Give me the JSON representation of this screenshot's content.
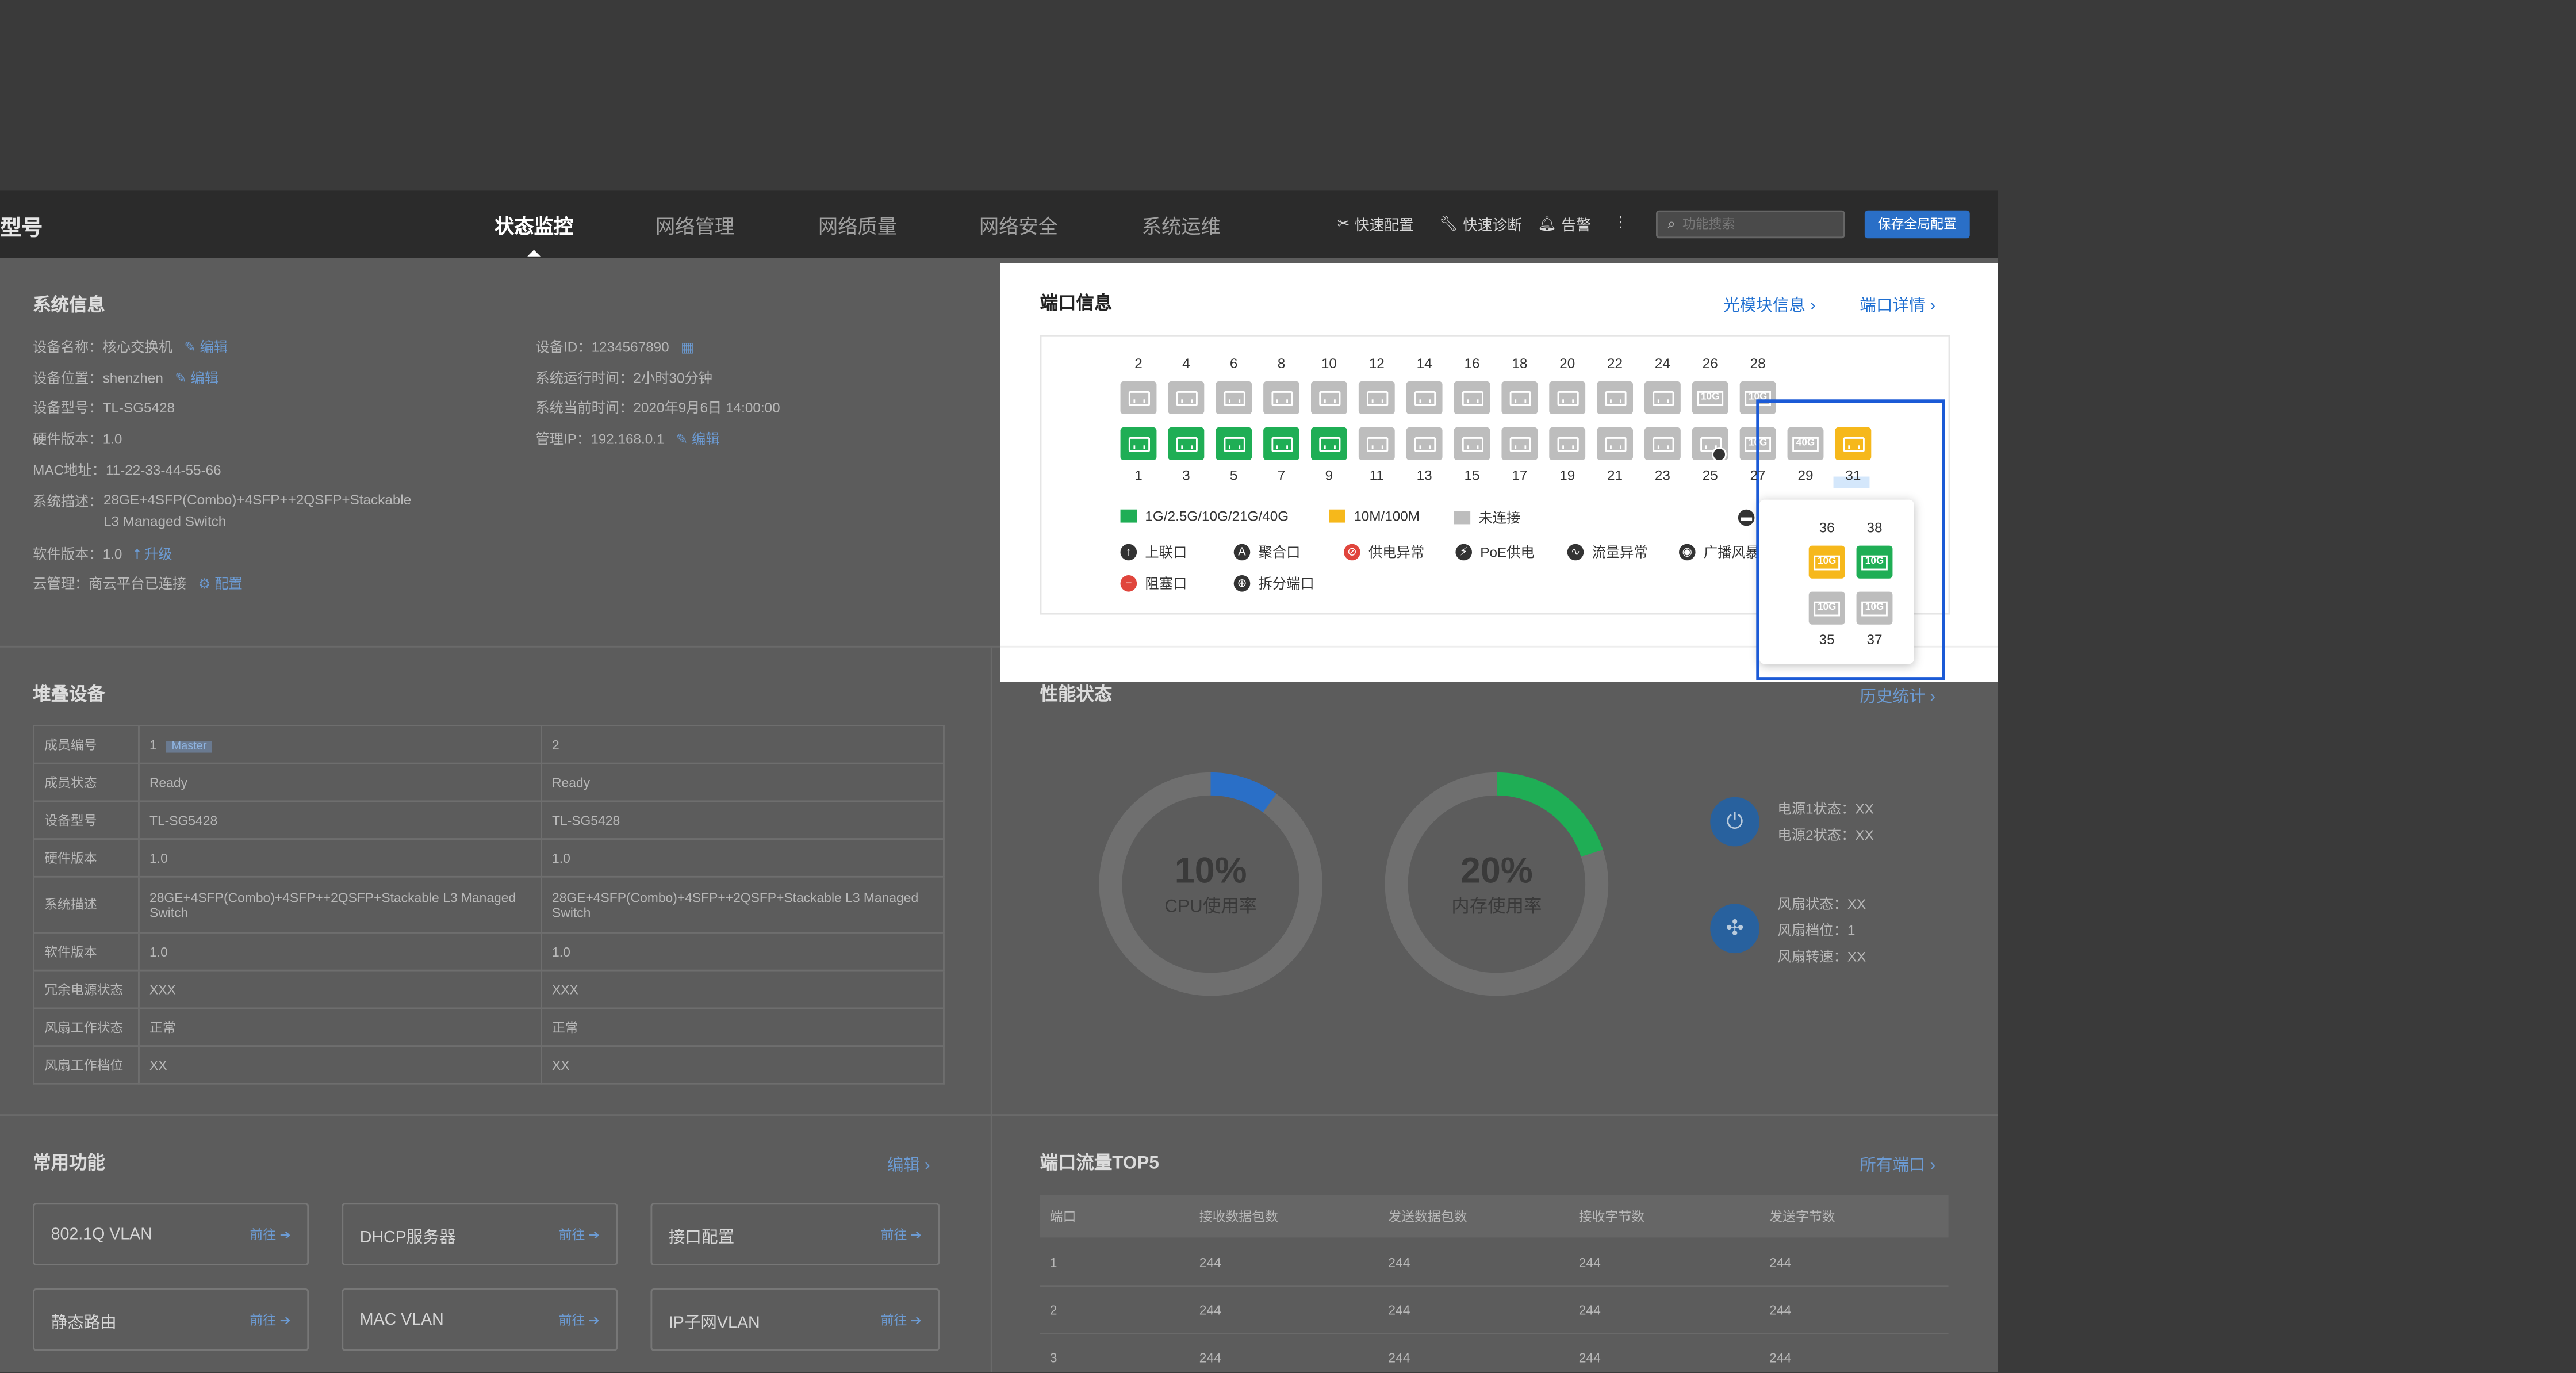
{
  "topbar": {
    "brand": "型号",
    "nav": [
      "状态监控",
      "网络管理",
      "网络质量",
      "网络安全",
      "系统运维"
    ],
    "quick_config": "快速配置",
    "quick_diag": "快速诊断",
    "alarm": "告警",
    "more": "⋮",
    "search_placeholder": "功能搜索",
    "save_button": "保存全局配置"
  },
  "system_info": {
    "title": "系统信息",
    "edit": "编辑",
    "device_name": "设备名称：核心交换机",
    "device_location": "设备位置：shenzhen",
    "device_model": "设备型号：TL-SG5428",
    "hw_version": "硬件版本：1.0",
    "mac": "MAC地址：11-22-33-44-55-66",
    "desc_label": "系统描述：",
    "desc_line1": "28GE+4SFP(Combo)+4SFP++2QSFP+Stackable",
    "desc_line2": "L3 Managed Switch",
    "sw_version": "软件版本：1.0",
    "upgrade": "升级",
    "cloud": "云管理：商云平台已连接",
    "config": "配置",
    "device_id": "设备ID：1234567890",
    "uptime": "系统运行时间：2小时30分钟",
    "current_time": "系统当前时间：2020年9月6日  14:00:00",
    "mgmt_ip": "管理IP：192.168.0.1"
  },
  "stack": {
    "title": "堆叠设备",
    "master_badge": "Master",
    "rows": [
      {
        "label": "成员编号",
        "a": "1",
        "b": "2"
      },
      {
        "label": "成员状态",
        "a": "Ready",
        "b": "Ready"
      },
      {
        "label": "设备型号",
        "a": "TL-SG5428",
        "b": "TL-SG5428"
      },
      {
        "label": "硬件版本",
        "a": "1.0",
        "b": "1.0"
      },
      {
        "label": "系统描述",
        "a": "28GE+4SFP(Combo)+4SFP++2QSFP+Stackable L3 Managed Switch",
        "b": "28GE+4SFP(Combo)+4SFP++2QSFP+Stackable L3 Managed Switch"
      },
      {
        "label": "软件版本",
        "a": "1.0",
        "b": "1.0"
      },
      {
        "label": "冗余电源状态",
        "a": "XXX",
        "b": "XXX"
      },
      {
        "label": "风扇工作状态",
        "a": "正常",
        "b": "正常"
      },
      {
        "label": "风扇工作档位",
        "a": "XX",
        "b": "XX"
      }
    ]
  },
  "common": {
    "title": "常用功能",
    "edit": "编辑",
    "go": "前往",
    "items": [
      "802.1Q VLAN",
      "DHCP服务器",
      "接口配置",
      "静态路由",
      "MAC VLAN",
      "IP子网VLAN"
    ]
  },
  "port_info": {
    "title": "端口信息",
    "optical_link": "光模块信息",
    "detail_link": "端口详情",
    "top_ports": [
      {
        "num": "2",
        "state": "gray",
        "kind": "eth"
      },
      {
        "num": "4",
        "state": "gray",
        "kind": "eth"
      },
      {
        "num": "6",
        "state": "gray",
        "kind": "eth"
      },
      {
        "num": "8",
        "state": "gray",
        "kind": "eth"
      },
      {
        "num": "10",
        "state": "gray",
        "kind": "eth"
      },
      {
        "num": "12",
        "state": "gray",
        "kind": "eth"
      },
      {
        "num": "14",
        "state": "gray",
        "kind": "eth"
      },
      {
        "num": "16",
        "state": "gray",
        "kind": "eth"
      },
      {
        "num": "18",
        "state": "gray",
        "kind": "eth"
      },
      {
        "num": "20",
        "state": "gray",
        "kind": "eth"
      },
      {
        "num": "22",
        "state": "gray",
        "kind": "eth"
      },
      {
        "num": "24",
        "state": "gray",
        "kind": "eth"
      },
      {
        "num": "26",
        "state": "gray",
        "kind": "sfp",
        "label": "10G"
      },
      {
        "num": "28",
        "state": "gray",
        "kind": "sfp",
        "label": "10G"
      }
    ],
    "bottom_ports": [
      {
        "num": "1",
        "state": "green",
        "kind": "eth"
      },
      {
        "num": "3",
        "state": "green",
        "kind": "eth"
      },
      {
        "num": "5",
        "state": "green",
        "kind": "eth"
      },
      {
        "num": "7",
        "state": "green",
        "kind": "eth"
      },
      {
        "num": "9",
        "state": "green",
        "kind": "eth"
      },
      {
        "num": "11",
        "state": "gray",
        "kind": "eth"
      },
      {
        "num": "13",
        "state": "gray",
        "kind": "eth"
      },
      {
        "num": "15",
        "state": "gray",
        "kind": "eth"
      },
      {
        "num": "17",
        "state": "gray",
        "kind": "eth"
      },
      {
        "num": "19",
        "state": "gray",
        "kind": "eth"
      },
      {
        "num": "21",
        "state": "gray",
        "kind": "eth"
      },
      {
        "num": "23",
        "state": "gray",
        "kind": "eth"
      },
      {
        "num": "25",
        "state": "gray",
        "kind": "eth"
      },
      {
        "num": "27",
        "state": "gray",
        "kind": "sfp",
        "label": "10G"
      },
      {
        "num": "29",
        "state": "gray",
        "kind": "sfp",
        "label": "40G"
      },
      {
        "num": "31",
        "state": "yellow",
        "kind": "eth"
      }
    ],
    "legend_speed": [
      {
        "label": "1G/2.5G/10G/21G/40G",
        "color": "#1fae55"
      },
      {
        "label": "10M/100M",
        "color": "#f6b81b"
      },
      {
        "label": "未连接",
        "color": "#bdbdbd"
      }
    ],
    "legend_icons": [
      "上联口",
      "聚合口",
      "供电异常",
      "PoE供电",
      "流量异常",
      "广播风暴",
      "电口",
      "阻塞口",
      "拆分端口"
    ],
    "popup": {
      "top_nums": [
        "36",
        "38"
      ],
      "bottom_nums": [
        "35",
        "37"
      ],
      "ports": [
        {
          "state": "yellow",
          "label": "10G"
        },
        {
          "state": "green",
          "label": "10G"
        },
        {
          "state": "gray",
          "label": "10G"
        },
        {
          "state": "gray",
          "label": "10G"
        }
      ]
    }
  },
  "performance": {
    "title": "性能状态",
    "history": "历史统计",
    "cpu": {
      "value": 0.1,
      "text": "10%",
      "label": "CPU使用率"
    },
    "mem": {
      "value": 0.2,
      "text": "20%",
      "label": "内存使用率"
    },
    "power1": "电源1状态：XX",
    "power2": "电源2状态：XX",
    "fan_state": "风扇状态：XX",
    "fan_level": "风扇档位：1",
    "fan_speed": "风扇转速：XX"
  },
  "traffic": {
    "title": "端口流量TOP5",
    "all_ports": "所有端口",
    "headers": [
      "端口",
      "接收数据包数",
      "发送数据包数",
      "接收字节数",
      "发送字节数"
    ],
    "rows": [
      [
        "1",
        "244",
        "244",
        "244",
        "244"
      ],
      [
        "2",
        "244",
        "244",
        "244",
        "244"
      ],
      [
        "3",
        "244",
        "244",
        "244",
        "244"
      ]
    ]
  },
  "colors": {
    "green": "#1fae55",
    "yellow": "#f6b81b",
    "gray": "#bdbdbd",
    "accent": "#2a6fc7",
    "highlight": "#1b5ad6"
  }
}
